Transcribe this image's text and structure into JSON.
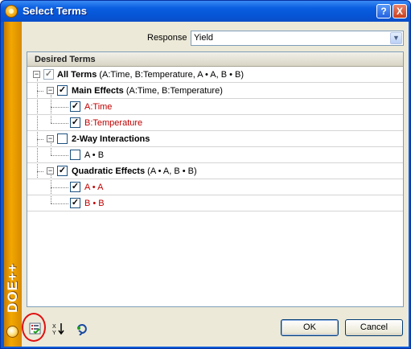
{
  "window": {
    "title": "Select Terms",
    "help_glyph": "?",
    "close_glyph": "X"
  },
  "brand": {
    "text": "DOE++"
  },
  "response": {
    "label": "Response",
    "value": "Yield"
  },
  "group": {
    "title": "Desired Terms"
  },
  "tree": {
    "all_terms": {
      "bold": "All Terms",
      "detail": " (A:Time, B:Temperature, A • A, B • B)",
      "checked": true
    },
    "main_effects": {
      "bold": "Main Effects",
      "detail": " (A:Time, B:Temperature)",
      "checked": true
    },
    "a_time": {
      "label": "A:Time",
      "checked": true
    },
    "b_temperature": {
      "label": "B:Temperature",
      "checked": true
    },
    "two_way": {
      "bold": "2-Way Interactions",
      "detail": "",
      "checked": false
    },
    "a_b": {
      "label": "A • B",
      "checked": false
    },
    "quadratic": {
      "bold": "Quadratic Effects",
      "detail": " (A • A, B • B)",
      "checked": true
    },
    "a_a": {
      "label": "A • A",
      "checked": true
    },
    "b_b": {
      "label": "B • B",
      "checked": true
    },
    "expander_glyph": "−",
    "check_glyph": "✓"
  },
  "buttons": {
    "ok": "OK",
    "cancel": "Cancel"
  },
  "colors": {
    "term_red": "#c00000",
    "title_blue": "#0a5ee0",
    "brand_orange": "#f2a800",
    "highlight_red": "#e01010"
  },
  "icons": [
    "select-terms-icon",
    "sort-terms-icon",
    "refresh-icon"
  ]
}
